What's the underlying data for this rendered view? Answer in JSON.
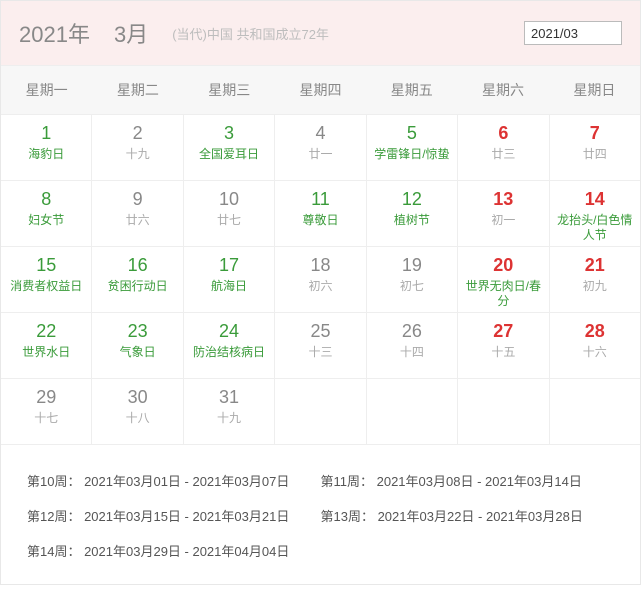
{
  "header": {
    "year": "2021年",
    "month": "3月",
    "subtitle": "(当代)中国 共和国成立72年",
    "input_value": "2021/03"
  },
  "weekdays": [
    "星期一",
    "星期二",
    "星期三",
    "星期四",
    "星期五",
    "星期六",
    "星期日"
  ],
  "days": [
    [
      {
        "n": "1",
        "nc": "green",
        "t": "海豹日",
        "tc": "green"
      },
      {
        "n": "2",
        "nc": "",
        "t": "十九",
        "tc": "gray"
      },
      {
        "n": "3",
        "nc": "green",
        "t": "全国爱耳日",
        "tc": "green"
      },
      {
        "n": "4",
        "nc": "",
        "t": "廿一",
        "tc": "gray"
      },
      {
        "n": "5",
        "nc": "green",
        "t": "学雷锋日/惊蛰",
        "tc": "green"
      },
      {
        "n": "6",
        "nc": "red",
        "t": "廿三",
        "tc": "gray"
      },
      {
        "n": "7",
        "nc": "red",
        "t": "廿四",
        "tc": "gray"
      }
    ],
    [
      {
        "n": "8",
        "nc": "green",
        "t": "妇女节",
        "tc": "green"
      },
      {
        "n": "9",
        "nc": "",
        "t": "廿六",
        "tc": "gray"
      },
      {
        "n": "10",
        "nc": "",
        "t": "廿七",
        "tc": "gray"
      },
      {
        "n": "11",
        "nc": "green",
        "t": "尊敬日",
        "tc": "green"
      },
      {
        "n": "12",
        "nc": "green",
        "t": "植树节",
        "tc": "green"
      },
      {
        "n": "13",
        "nc": "red",
        "t": "初一",
        "tc": "gray"
      },
      {
        "n": "14",
        "nc": "red",
        "t": "龙抬头/白色情人节",
        "tc": "green"
      }
    ],
    [
      {
        "n": "15",
        "nc": "green",
        "t": "消费者权益日",
        "tc": "green"
      },
      {
        "n": "16",
        "nc": "green",
        "t": "贫困行动日",
        "tc": "green"
      },
      {
        "n": "17",
        "nc": "green",
        "t": "航海日",
        "tc": "green"
      },
      {
        "n": "18",
        "nc": "",
        "t": "初六",
        "tc": "gray"
      },
      {
        "n": "19",
        "nc": "",
        "t": "初七",
        "tc": "gray"
      },
      {
        "n": "20",
        "nc": "red",
        "t": "世界无肉日/春分",
        "tc": "green"
      },
      {
        "n": "21",
        "nc": "red",
        "t": "初九",
        "tc": "gray"
      }
    ],
    [
      {
        "n": "22",
        "nc": "green",
        "t": "世界水日",
        "tc": "green"
      },
      {
        "n": "23",
        "nc": "green",
        "t": "气象日",
        "tc": "green"
      },
      {
        "n": "24",
        "nc": "green",
        "t": "防治结核病日",
        "tc": "green"
      },
      {
        "n": "25",
        "nc": "",
        "t": "十三",
        "tc": "gray"
      },
      {
        "n": "26",
        "nc": "",
        "t": "十四",
        "tc": "gray"
      },
      {
        "n": "27",
        "nc": "red",
        "t": "十五",
        "tc": "gray"
      },
      {
        "n": "28",
        "nc": "red",
        "t": "十六",
        "tc": "gray"
      }
    ],
    [
      {
        "n": "29",
        "nc": "",
        "t": "十七",
        "tc": "gray"
      },
      {
        "n": "30",
        "nc": "",
        "t": "十八",
        "tc": "gray"
      },
      {
        "n": "31",
        "nc": "",
        "t": "十九",
        "tc": "gray"
      },
      {
        "n": "",
        "nc": "",
        "t": "",
        "tc": ""
      },
      {
        "n": "",
        "nc": "",
        "t": "",
        "tc": ""
      },
      {
        "n": "",
        "nc": "",
        "t": "",
        "tc": ""
      },
      {
        "n": "",
        "nc": "",
        "t": "",
        "tc": ""
      }
    ]
  ],
  "weeks": [
    {
      "label": "第10周：",
      "range": "2021年03月01日 - 2021年03月07日"
    },
    {
      "label": "第11周：",
      "range": "2021年03月08日 - 2021年03月14日"
    },
    {
      "label": "第12周：",
      "range": "2021年03月15日 - 2021年03月21日"
    },
    {
      "label": "第13周：",
      "range": "2021年03月22日 - 2021年03月28日"
    },
    {
      "label": "第14周：",
      "range": "2021年03月29日 - 2021年04月04日"
    }
  ]
}
